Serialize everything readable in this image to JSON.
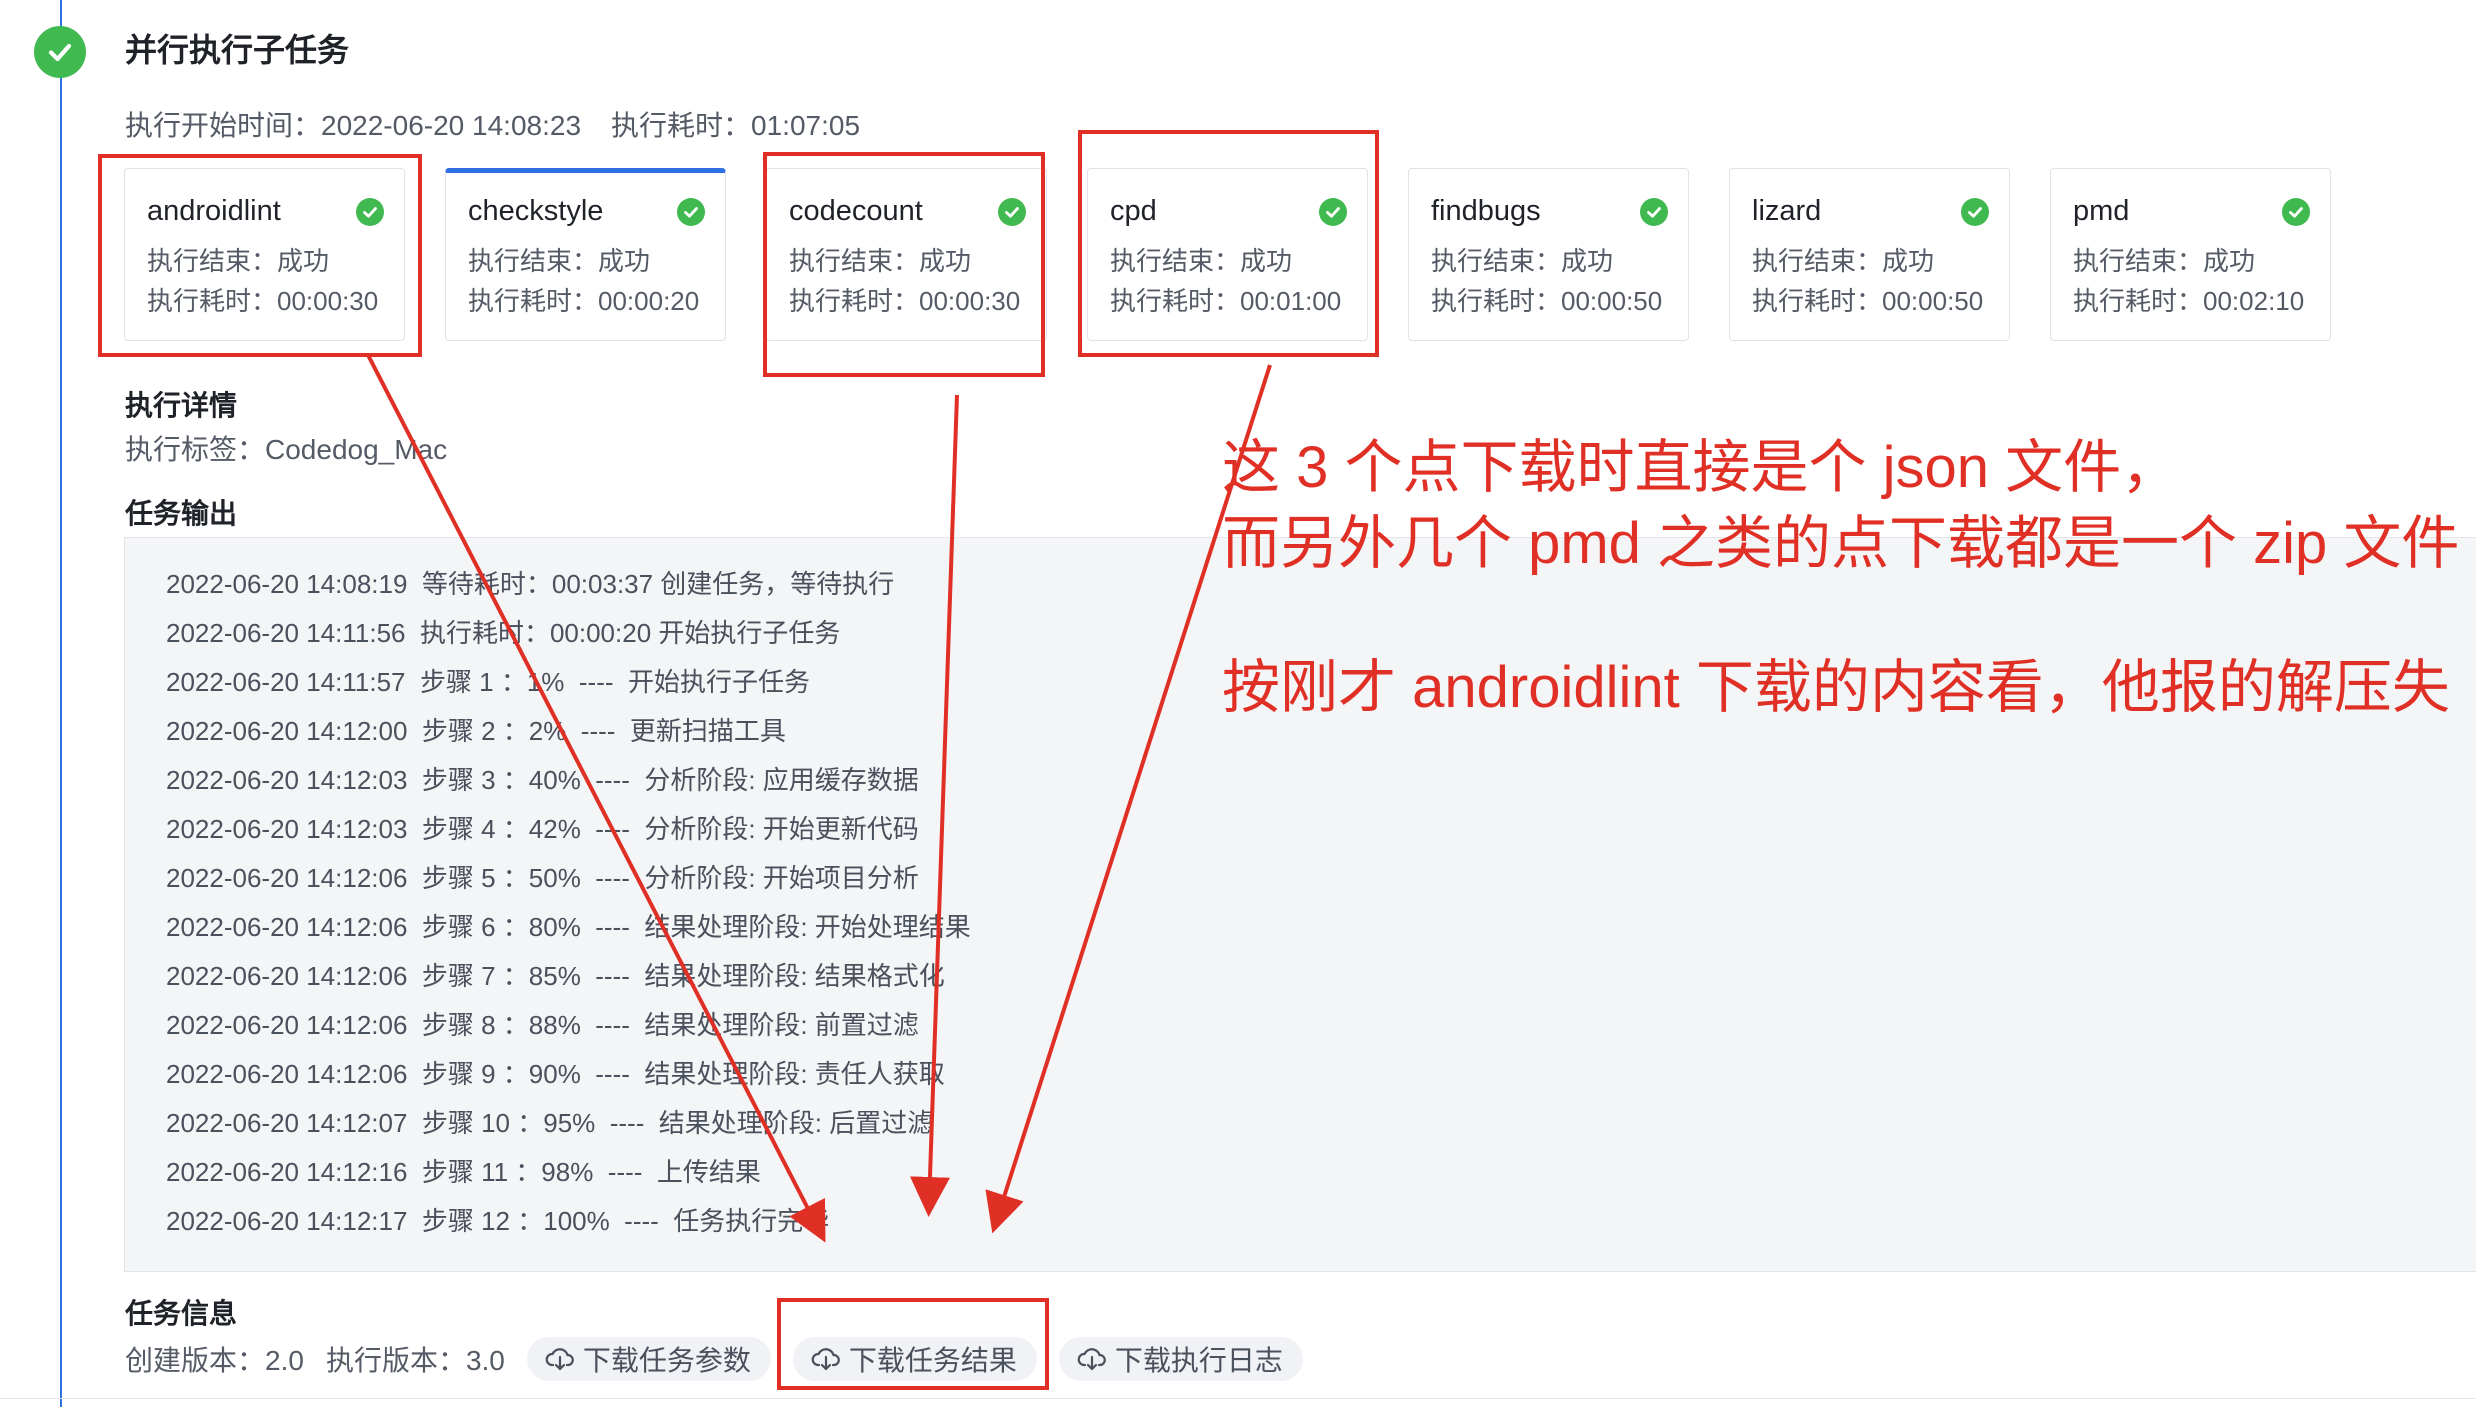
{
  "step": {
    "title": "并行执行子任务",
    "start_label": "执行开始时间：",
    "start_value": "2022-06-20 14:08:23",
    "duration_label": "执行耗时：",
    "duration_value": "01:07:05",
    "status_icon": "check-circle-icon",
    "status_color": "#3fb950"
  },
  "cards": [
    {
      "name": "androidlint",
      "result": "执行结束：成功",
      "duration": "执行耗时：00:00:30",
      "icon": "check-circle-icon"
    },
    {
      "name": "checkstyle",
      "result": "执行结束：成功",
      "duration": "执行耗时：00:00:20",
      "icon": "check-circle-icon"
    },
    {
      "name": "codecount",
      "result": "执行结束：成功",
      "duration": "执行耗时：00:00:30",
      "icon": "check-circle-icon"
    },
    {
      "name": "cpd",
      "result": "执行结束：成功",
      "duration": "执行耗时：00:01:00",
      "icon": "check-circle-icon"
    },
    {
      "name": "findbugs",
      "result": "执行结束：成功",
      "duration": "执行耗时：00:00:50",
      "icon": "check-circle-icon"
    },
    {
      "name": "lizard",
      "result": "执行结束：成功",
      "duration": "执行耗时：00:00:50",
      "icon": "check-circle-icon"
    },
    {
      "name": "pmd",
      "result": "执行结束：成功",
      "duration": "执行耗时：00:02:10",
      "icon": "check-circle-icon"
    }
  ],
  "details": {
    "title": "执行详情",
    "tag": "执行标签：Codedog_Mac"
  },
  "output": {
    "title": "任务输出",
    "logs": [
      "2022-06-20 14:08:19  等待耗时：00:03:37 创建任务，等待执行",
      "2022-06-20 14:11:56  执行耗时：00:00:20 开始执行子任务",
      "2022-06-20 14:11:57  步骤 1 ：1%  ----  开始执行子任务",
      "2022-06-20 14:12:00  步骤 2 ：2%  ----  更新扫描工具",
      "2022-06-20 14:12:03  步骤 3 ：40%  ----  分析阶段: 应用缓存数据",
      "2022-06-20 14:12:03  步骤 4 ：42%  ----  分析阶段: 开始更新代码",
      "2022-06-20 14:12:06  步骤 5 ：50%  ----  分析阶段: 开始项目分析",
      "2022-06-20 14:12:06  步骤 6 ：80%  ----  结果处理阶段: 开始处理结果",
      "2022-06-20 14:12:06  步骤 7 ：85%  ----  结果处理阶段: 结果格式化",
      "2022-06-20 14:12:06  步骤 8 ：88%  ----  结果处理阶段: 前置过滤",
      "2022-06-20 14:12:06  步骤 9 ：90%  ----  结果处理阶段: 责任人获取",
      "2022-06-20 14:12:07  步骤 10 ：95%  ----  结果处理阶段: 后置过滤",
      "2022-06-20 14:12:16  步骤 11 ：98%  ----  上传结果",
      "2022-06-20 14:12:17  步骤 12 ：100%  ----  任务执行完毕"
    ]
  },
  "info": {
    "title": "任务信息",
    "created_version": "创建版本：2.0",
    "exec_version": "执行版本：3.0",
    "buttons": [
      {
        "label": "下载任务参数",
        "icon": "cloud-download-icon"
      },
      {
        "label": "下载任务结果",
        "icon": "cloud-download-icon"
      },
      {
        "label": "下载执行日志",
        "icon": "cloud-download-icon"
      }
    ]
  },
  "annotation": {
    "color": "#e02f25",
    "line1": "这 3 个点下载时直接是个 json 文件，",
    "line2": "而另外几个 pmd 之类的点下载都是一个 zip 文件",
    "line3": "按刚才 androidlint 下载的内容看，他报的解压失"
  }
}
